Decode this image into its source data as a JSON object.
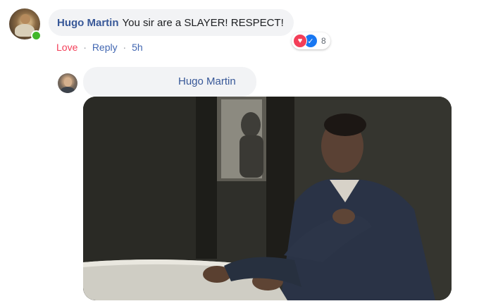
{
  "comment": {
    "author": "Hugo Martin",
    "text": "You sir are a SLAYER! RESPECT!",
    "reaction_count": "8",
    "actions": {
      "love": "Love",
      "reply": "Reply",
      "time": "5h",
      "separator": "·"
    }
  },
  "reply": {
    "author": "Hugo Martin",
    "gif_label": ""
  },
  "icons": {
    "reaction_heart": "heart-icon",
    "reaction_like": "like-icon"
  },
  "colors": {
    "author_link": "#385898",
    "love_action": "#f33e58",
    "reply_action": "#4267b2",
    "bubble_bg": "#f2f3f5",
    "online": "#42b72a"
  }
}
